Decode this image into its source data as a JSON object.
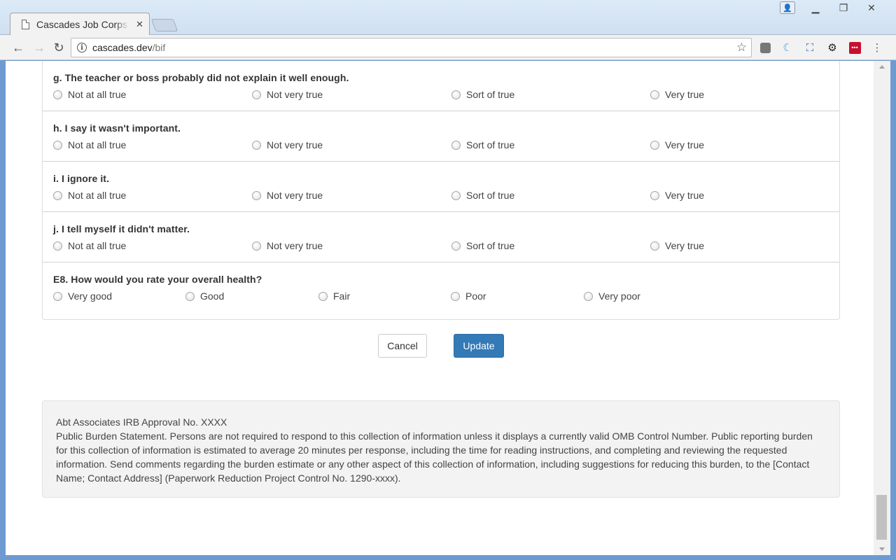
{
  "browser": {
    "tab_title": "Cascades Job Corps",
    "url_host": "cascades.dev",
    "url_path": "/bif"
  },
  "questions": [
    {
      "label": "g. The teacher or boss probably did not explain it well enough.",
      "options": [
        "Not at all true",
        "Not very true",
        "Sort of true",
        "Very true"
      ]
    },
    {
      "label": "h. I say it wasn't important.",
      "options": [
        "Not at all true",
        "Not very true",
        "Sort of true",
        "Very true"
      ]
    },
    {
      "label": "i. I ignore it.",
      "options": [
        "Not at all true",
        "Not very true",
        "Sort of true",
        "Very true"
      ]
    },
    {
      "label": "j. I tell myself it didn't matter.",
      "options": [
        "Not at all true",
        "Not very true",
        "Sort of true",
        "Very true"
      ]
    },
    {
      "label": "E8. How would you rate your overall health?",
      "options": [
        "Very good",
        "Good",
        "Fair",
        "Poor",
        "Very poor"
      ]
    }
  ],
  "actions": {
    "cancel_label": "Cancel",
    "update_label": "Update"
  },
  "footer": {
    "irb": "Abt Associates IRB Approval No. XXXX",
    "statement": "Public Burden Statement. Persons are not required to respond to this collection of information unless it displays a currently valid OMB Control Number. Public reporting burden for this collection of information is estimated to average 20 minutes per response, including the time for reading instructions, and completing and reviewing the requested information. Send comments regarding the burden estimate or any other aspect of this collection of information, including suggestions for reducing this burden, to the [Contact Name; Contact Address] (Paperwork Reduction Project Control No. 1290-xxxx)."
  }
}
